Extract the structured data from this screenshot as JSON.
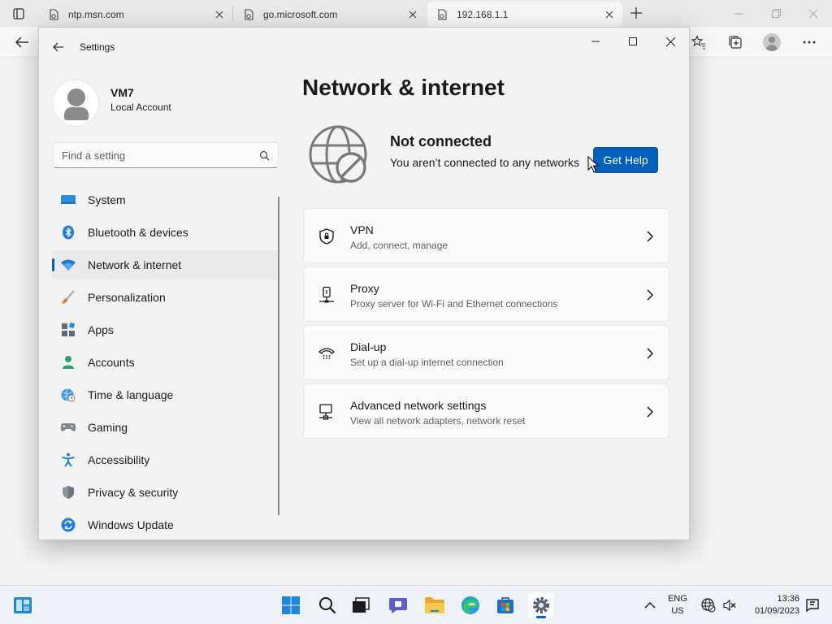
{
  "browser": {
    "tabs": [
      {
        "label": "ntp.msn.com",
        "active": false
      },
      {
        "label": "go.microsoft.com",
        "active": false
      },
      {
        "label": "192.168.1.1",
        "active": true
      }
    ]
  },
  "settings": {
    "window_title": "Settings",
    "profile": {
      "name": "VM7",
      "account_type": "Local Account"
    },
    "search": {
      "placeholder": "Find a setting"
    },
    "nav_items": [
      {
        "label": "System",
        "icon": "monitor-icon",
        "active": false
      },
      {
        "label": "Bluetooth & devices",
        "icon": "bluetooth-icon",
        "active": false
      },
      {
        "label": "Network & internet",
        "icon": "wifi-icon",
        "active": true
      },
      {
        "label": "Personalization",
        "icon": "brush-icon",
        "active": false
      },
      {
        "label": "Apps",
        "icon": "apps-icon",
        "active": false
      },
      {
        "label": "Accounts",
        "icon": "person-icon",
        "active": false
      },
      {
        "label": "Time & language",
        "icon": "globe-clock-icon",
        "active": false
      },
      {
        "label": "Gaming",
        "icon": "gamepad-icon",
        "active": false
      },
      {
        "label": "Accessibility",
        "icon": "accessibility-icon",
        "active": false
      },
      {
        "label": "Privacy & security",
        "icon": "shield-icon",
        "active": false
      },
      {
        "label": "Windows Update",
        "icon": "update-icon",
        "active": false
      }
    ],
    "page_title": "Network & internet",
    "status": {
      "title": "Not connected",
      "subtitle": "You aren’t connected to any networks",
      "button": "Get Help"
    },
    "cards": [
      {
        "title": "VPN",
        "subtitle": "Add, connect, manage",
        "icon": "vpn-shield-icon"
      },
      {
        "title": "Proxy",
        "subtitle": "Proxy server for Wi-Fi and Ethernet connections",
        "icon": "proxy-icon"
      },
      {
        "title": "Dial-up",
        "subtitle": "Set up a dial-up internet connection",
        "icon": "dialup-icon"
      },
      {
        "title": "Advanced network settings",
        "subtitle": "View all network adapters, network reset",
        "icon": "advanced-network-icon"
      }
    ]
  },
  "taskbar": {
    "language": {
      "line1": "ENG",
      "line2": "US"
    },
    "time": "13:36",
    "date": "01/09/2023"
  },
  "colors": {
    "accent": "#005fb8",
    "window_bg": "#f3f3f3",
    "card_bg": "#fbfbfb"
  }
}
